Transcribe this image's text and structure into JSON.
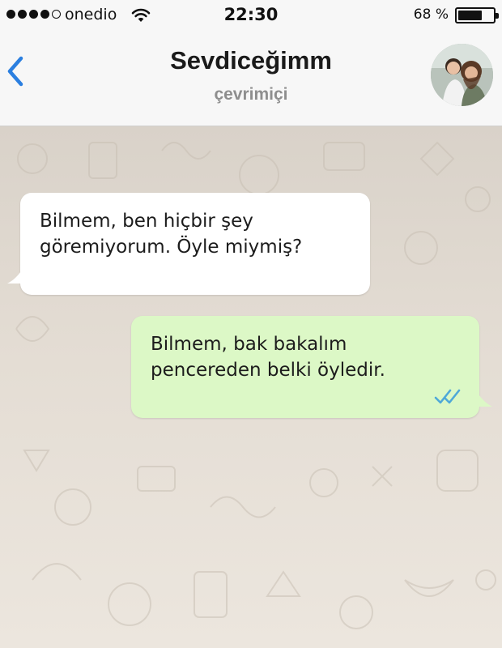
{
  "status_bar": {
    "carrier": "onedio",
    "time": "22:30",
    "battery_text": "68 %",
    "battery_level": 0.68
  },
  "header": {
    "contact_name": "Sevdiceğimm",
    "contact_status": "çevrimiçi"
  },
  "icons": {
    "back": "chevron-left-icon",
    "wifi": "wifi-icon",
    "battery": "battery-icon",
    "read_receipt": "double-check-icon"
  },
  "colors": {
    "accent": "#2b7fe0",
    "incoming_bubble": "#ffffff",
    "outgoing_bubble": "#dcf8c6",
    "read_ticks": "#4fa8d8",
    "status_text": "#8e8e8e"
  },
  "messages": [
    {
      "direction": "incoming",
      "text": "Bilmem, ben hiçbir şey\ngöremiyorum. Öyle miymiş?"
    },
    {
      "direction": "outgoing",
      "text": "Bilmem, bak bakalım\npencereden belki öyledir.",
      "status": "read"
    }
  ]
}
